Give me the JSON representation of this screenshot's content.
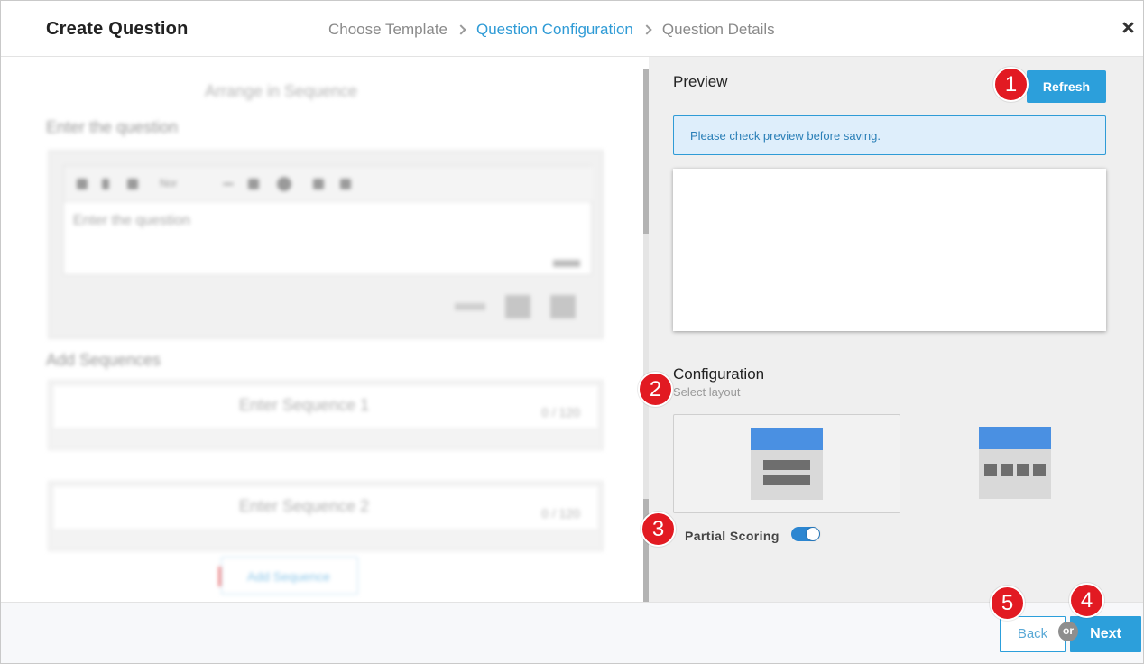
{
  "header": {
    "title": "Create Question",
    "breadcrumbs": [
      {
        "label": "Choose Template",
        "active": false
      },
      {
        "label": "Question Configuration",
        "active": true
      },
      {
        "label": "Question Details",
        "active": false
      }
    ],
    "close_icon": "close-icon"
  },
  "editor": {
    "template_name": "Arrange in Sequence",
    "question_label": "Enter the question",
    "question_placeholder": "Enter the question",
    "toolbar_style": "Nor",
    "sequences_label": "Add Sequences",
    "sequences": [
      {
        "placeholder": "Enter Sequence 1",
        "count": "0 / 120"
      },
      {
        "placeholder": "Enter Sequence 2",
        "count": "0 / 120"
      }
    ],
    "add_sequence_label": "Add Sequence"
  },
  "preview": {
    "title": "Preview",
    "refresh_label": "Refresh",
    "notice": "Please check preview before saving."
  },
  "configuration": {
    "title": "Configuration",
    "subtitle": "Select layout",
    "layouts": [
      {
        "name": "vertical-rows-layout",
        "selected": true
      },
      {
        "name": "horizontal-tiles-layout",
        "selected": false
      }
    ],
    "partial_scoring_label": "Partial Scoring",
    "partial_scoring_on": true
  },
  "footer": {
    "back_label": "Back",
    "or_label": "or",
    "next_label": "Next"
  },
  "markers": [
    "1",
    "2",
    "3",
    "4",
    "5"
  ],
  "colors": {
    "accent": "#2c9fdb",
    "layout_header": "#4a90e2",
    "marker": "#e21a22",
    "notice_bg": "#deeefb"
  }
}
